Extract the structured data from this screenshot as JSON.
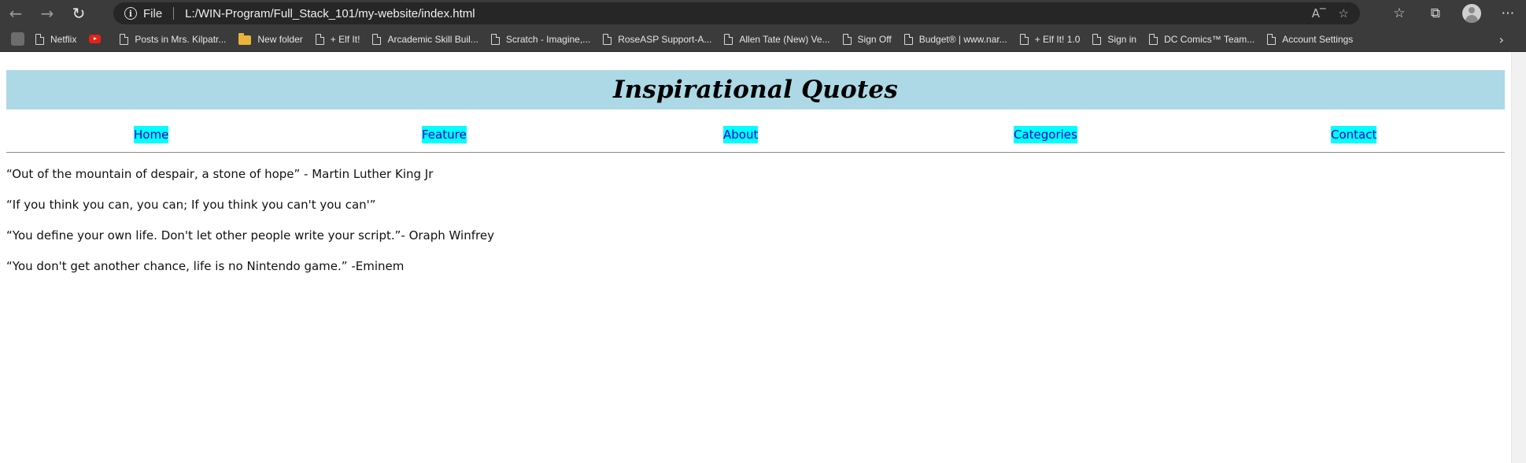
{
  "browser": {
    "address": {
      "scheme_label": "File",
      "url": "L:/WIN-Program/Full_Stack_101/my-website/index.html"
    },
    "bookmarks": [
      {
        "label": "Netflix",
        "icon": "page-icon"
      },
      {
        "label": "",
        "icon": "youtube-icon"
      },
      {
        "label": "Posts in Mrs. Kilpatr...",
        "icon": "page-icon"
      },
      {
        "label": "New folder",
        "icon": "folder-icon"
      },
      {
        "label": "+ Elf It!",
        "icon": "page-icon"
      },
      {
        "label": "Arcademic Skill Buil...",
        "icon": "page-icon"
      },
      {
        "label": "Scratch - Imagine,...",
        "icon": "page-icon"
      },
      {
        "label": "RoseASP Support-A...",
        "icon": "page-icon"
      },
      {
        "label": "Allen Tate (New) Ve...",
        "icon": "page-icon"
      },
      {
        "label": "Sign Off",
        "icon": "page-icon"
      },
      {
        "label": "Budget® | www.nar...",
        "icon": "page-icon"
      },
      {
        "label": "+ Elf It! 1.0",
        "icon": "page-icon"
      },
      {
        "label": "Sign in",
        "icon": "page-icon"
      },
      {
        "label": "DC Comics™ Team...",
        "icon": "page-icon"
      },
      {
        "label": "Account Settings",
        "icon": "page-icon"
      }
    ]
  },
  "page": {
    "title": "Inspirational Quotes",
    "nav": {
      "home": "Home",
      "feature": "Feature",
      "about": "About",
      "categories": "Categories",
      "contact": "Contact"
    },
    "nav_colors": {
      "background": "#00ffff",
      "text": "#0000cc"
    },
    "header_background": "#add8e6",
    "quotes": [
      "“Out of the mountain of despair, a stone of hope” - Martin Luther King Jr",
      "“If you think you can, you can; If you think you can't you can'”",
      "“You define your own life. Don't let other people write your script.”- Oraph Winfrey",
      "“You don't get another chance, life is no Nintendo game.” -Eminem"
    ]
  }
}
